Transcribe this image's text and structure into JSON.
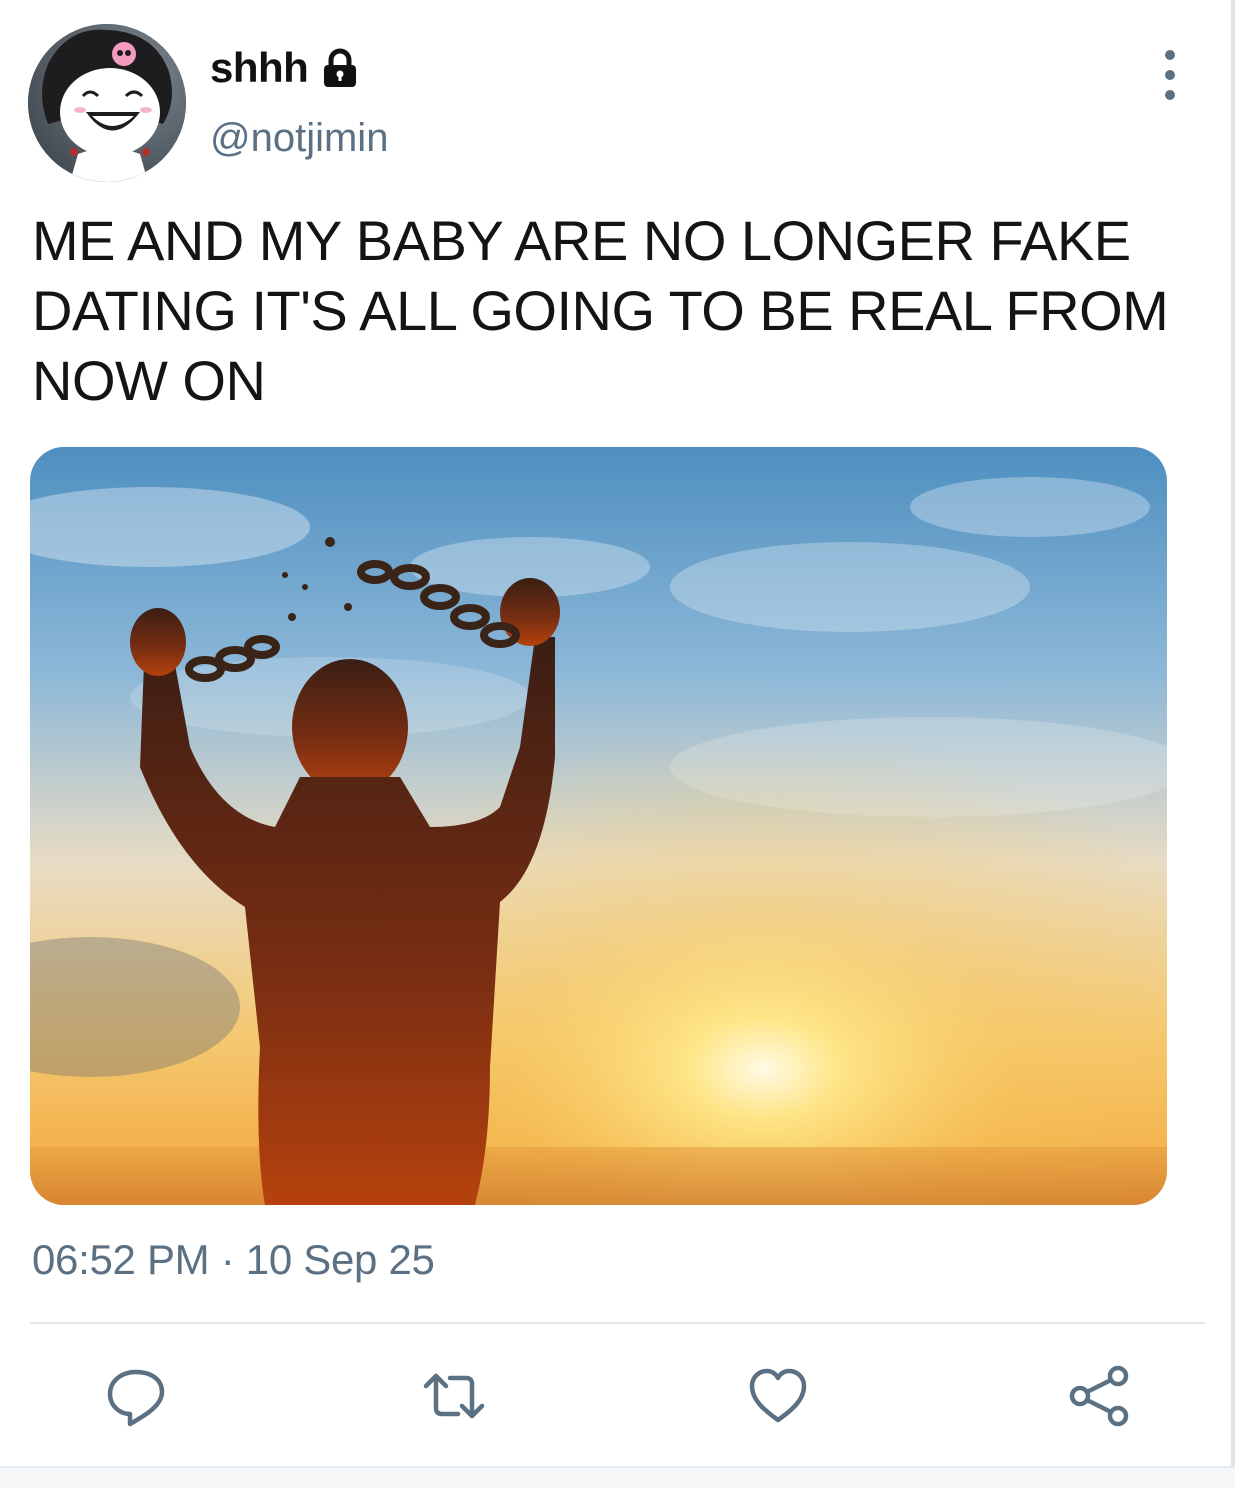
{
  "tweet": {
    "display_name": "shhh",
    "handle": "@notjimin",
    "text": "ME AND MY BABY ARE NO LONGER FAKE DATING IT'S ALL GOING TO BE REAL FROM NOW ON",
    "timestamp": "06:52 PM · 10 Sep 25",
    "account_status_icon": "lock-icon",
    "media_description_icon": "image"
  },
  "actions": [
    {
      "name": "reply-icon"
    },
    {
      "name": "retweet-icon"
    },
    {
      "name": "like-icon"
    },
    {
      "name": "share-icon"
    }
  ],
  "colors": {
    "secondary_text": "#5b7083",
    "primary_text": "#141414",
    "divider": "#e1e8ed"
  }
}
